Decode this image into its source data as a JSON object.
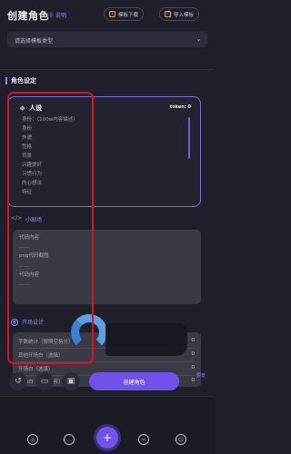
{
  "header": {
    "title": "创建角色",
    "help_label": "⓪ 说明",
    "buttons": [
      {
        "label": "模板下载",
        "icon": "download-icon"
      },
      {
        "label": "导入模板",
        "icon": "import-icon"
      }
    ]
  },
  "dropdown": {
    "value": "请选择模板类型"
  },
  "section": {
    "title": "角色设定"
  },
  "persona_card": {
    "title": "人设",
    "tokens": "token: 0",
    "lines": [
      "身份：（100w内容描述）",
      "身份",
      "外貌",
      "性格",
      "背景",
      "兴趣爱好",
      "习惯行为",
      "内心想法",
      "特征"
    ]
  },
  "dialogue": {
    "title": "小剧场",
    "lines": [
      "代码内容",
      "……",
      "png代码截图",
      "……",
      "代码内容",
      "……"
    ]
  },
  "opening": {
    "title": "开场设计",
    "rows": [
      {
        "label": "字数统计（按照空格分）",
        "value": "0"
      },
      {
        "label": "其他开场白（选填）",
        "value": "0"
      },
      {
        "label": "开场白（选填）",
        "value": "0"
      },
      {
        "label": "开场白（角色内容）",
        "value": "0"
      }
    ]
  },
  "bottom_bar": {
    "create_label": "创建角色",
    "side_label": "预览"
  },
  "nav": {
    "items": [
      "compass-icon",
      "chat-icon",
      "plus-icon",
      "group-icon",
      "profile-icon"
    ]
  },
  "colors": {
    "accent": "#6f52e8",
    "highlight_box": "#d9141b",
    "background": "#1f1f2b"
  }
}
